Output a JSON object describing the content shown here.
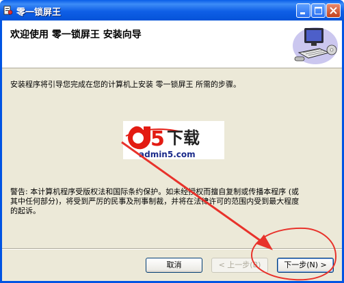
{
  "window": {
    "title": "零一锁屏王"
  },
  "header": {
    "title": "欢迎使用 零一锁屏王 安装向导"
  },
  "body": {
    "intro": "安装程序将引导您完成在您的计算机上安装 零一锁屏王 所需的步骤。",
    "warning_line1": "警告: 本计算机程序受版权法和国际条约保护。如未经授权而擅自复制或传播本程序 (或",
    "warning_line2": "其中任何部分)，将受到严厉的民事及刑事制裁，并将在法律许可的范围内受到最大程度",
    "warning_line3": "的起诉。"
  },
  "watermark": {
    "brand_text": "下载",
    "brand_number": "5",
    "url": "admin5.com"
  },
  "buttons": {
    "cancel": "取消",
    "back": "< 上一步(B)",
    "next": "下一步(N) >"
  },
  "colors": {
    "annotation": "#e8322b",
    "titlebar": "#0054e3"
  }
}
